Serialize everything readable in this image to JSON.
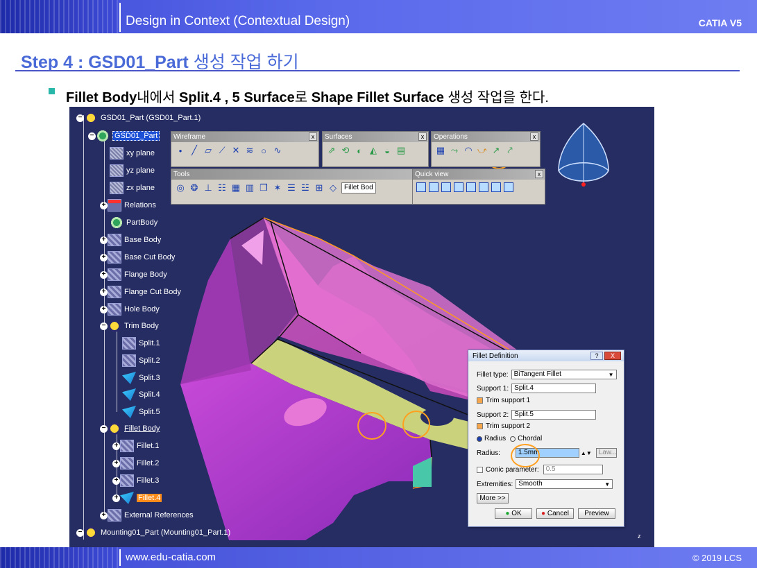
{
  "header": {
    "title": "Design in Context (Contextual Design)",
    "brand": "CATIA V5"
  },
  "step": {
    "label": "Step 4 : GSD01_Part",
    "korean": " 생성 작업 하기"
  },
  "bullet": {
    "p1": "Fillet Body",
    "p2": "내에서 ",
    "p3": "Split.4 , 5 Surface",
    "p4": "로 ",
    "p5": "Shape Fillet Surface",
    "p6": " 생성 작업을 한다."
  },
  "tree": {
    "root": "GSD01_Part (GSD01_Part.1)",
    "part": "GSD01_Part",
    "xy": "xy plane",
    "yz": "yz plane",
    "zx": "zx plane",
    "relations": "Relations",
    "partbody": "PartBody",
    "base": "Base Body",
    "basecut": "Base Cut Body",
    "flange": "Flange Body",
    "flangecut": "Flange Cut Body",
    "hole": "Hole Body",
    "trim": "Trim Body",
    "splits": [
      "Split.1",
      "Split.2",
      "Split.3",
      "Split.4",
      "Split.5"
    ],
    "fillet": "Fillet Body",
    "fillets": [
      "Fillet.1",
      "Fillet.2",
      "Fillet.3",
      "Fillet.4"
    ],
    "ext": "External References",
    "mounting": "Mounting01_Part (Mounting01_Part.1)"
  },
  "toolbars": {
    "wireframe": "Wireframe",
    "surfaces": "Surfaces",
    "operations": "Operations",
    "tools": "Tools",
    "quickview": "Quick view",
    "combo": "Fillet Bod",
    "close": "x"
  },
  "dialog": {
    "title": "Fillet Definition",
    "help": "?",
    "close": "X",
    "fillet_type_label": "Fillet type:",
    "fillet_type_value": "BiTangent Fillet",
    "support1_label": "Support 1:",
    "support1_value": "Split.4",
    "trim1": "Trim support 1",
    "support2_label": "Support 2:",
    "support2_value": "Split.5",
    "trim2": "Trim support 2",
    "radius_opt": "Radius",
    "chordal_opt": "Chordal",
    "radius_label": "Radius:",
    "radius_value": "1.5mm",
    "law": "Law...",
    "conic_label": "Conic parameter:",
    "conic_value": "0.5",
    "extremities_label": "Extremities:",
    "extremities_value": "Smooth",
    "more": "More >>",
    "ok": "OK",
    "cancel": "Cancel",
    "preview": "Preview"
  },
  "viewport": {
    "z_axis": "z"
  },
  "footer": {
    "url": "www.edu-catia.com",
    "copyright": "© 2019 LCS"
  }
}
